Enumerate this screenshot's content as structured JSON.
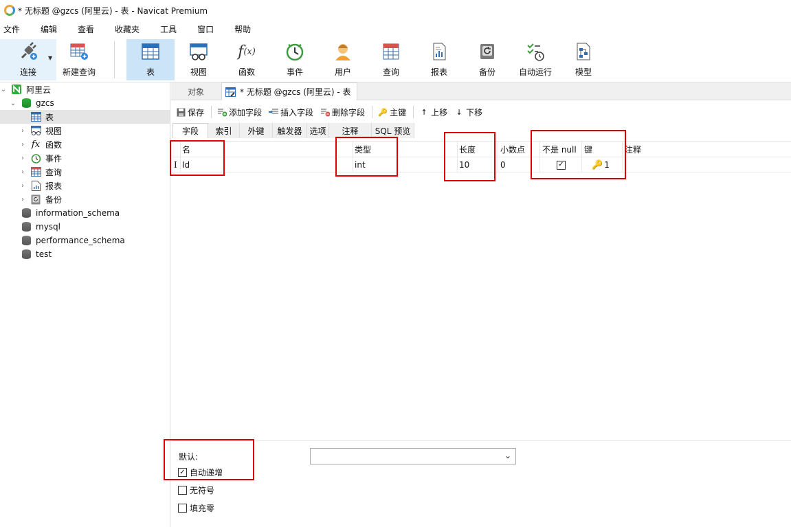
{
  "window": {
    "title": "* 无标题 @gzcs (阿里云) - 表 - Navicat Premium"
  },
  "menu": [
    "文件",
    "编辑",
    "查看",
    "收藏夹",
    "工具",
    "窗口",
    "帮助"
  ],
  "toolbar": {
    "connect": "连接",
    "new_query": "新建查询",
    "table": "表",
    "view": "视图",
    "function": "函数",
    "event": "事件",
    "user": "用户",
    "query": "查询",
    "report": "报表",
    "backup": "备份",
    "auto_run": "自动运行",
    "model": "模型"
  },
  "sidebar": {
    "connection": "阿里云",
    "database": "gzcs",
    "items": [
      "表",
      "视图",
      "函数",
      "事件",
      "查询",
      "报表",
      "备份"
    ],
    "other_dbs": [
      "information_schema",
      "mysql",
      "performance_schema",
      "test"
    ]
  },
  "tabs": {
    "objects": "对象",
    "current": "* 无标题 @gzcs (阿里云) - 表"
  },
  "actions": {
    "save": "保存",
    "add_field": "添加字段",
    "insert_field": "插入字段",
    "delete_field": "删除字段",
    "primary_key": "主键",
    "move_up": "上移",
    "move_down": "下移"
  },
  "field_tabs": [
    "字段",
    "索引",
    "外键",
    "触发器",
    "选项",
    "注释",
    "SQL 预览"
  ],
  "columns": {
    "name": "名",
    "type": "类型",
    "length": "长度",
    "decimals": "小数点",
    "not_null": "不是 null",
    "key": "键",
    "comment": "注释"
  },
  "rows": [
    {
      "name": "Id",
      "type": "int",
      "length": "10",
      "decimals": "0",
      "not_null": true,
      "key": "1",
      "comment": ""
    }
  ],
  "options": {
    "default_label": "默认:",
    "default_value": "",
    "auto_increment": "自动递增",
    "auto_increment_checked": true,
    "unsigned": "无符号",
    "unsigned_checked": false,
    "zerofill": "填充零",
    "zerofill_checked": false
  },
  "colors": {
    "highlight": "#e00000",
    "active_tool": "#cce4f7",
    "key_icon": "#e8a020"
  }
}
